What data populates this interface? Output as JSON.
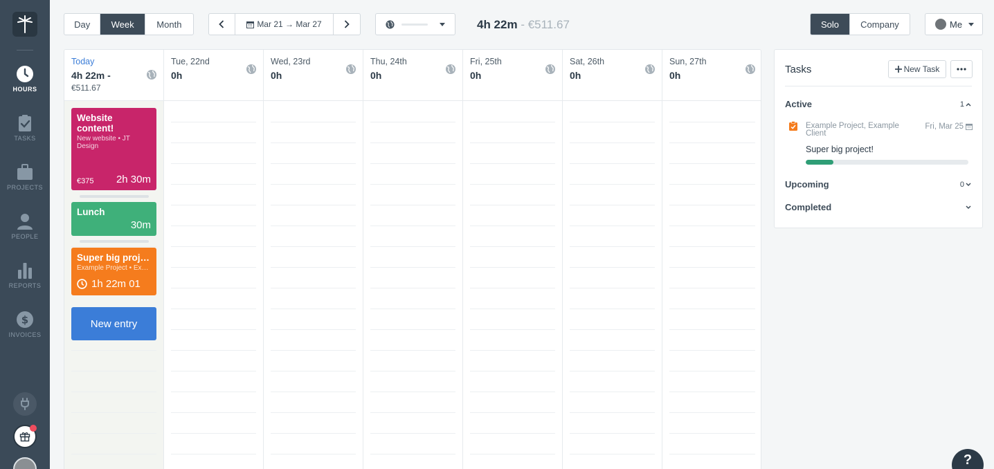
{
  "sidebar": {
    "items": [
      {
        "label": "HOURS",
        "icon": "clock-icon",
        "active": true
      },
      {
        "label": "TASKS",
        "icon": "clipboard-check-icon",
        "active": false
      },
      {
        "label": "PROJECTS",
        "icon": "briefcase-icon",
        "active": false
      },
      {
        "label": "PEOPLE",
        "icon": "person-icon",
        "active": false
      },
      {
        "label": "REPORTS",
        "icon": "bar-chart-icon",
        "active": false
      },
      {
        "label": "INVOICES",
        "icon": "dollar-icon",
        "active": false
      }
    ]
  },
  "toolbar": {
    "views": [
      "Day",
      "Week",
      "Month"
    ],
    "active_view": "Week",
    "date_range": "Mar 21 → Mar 27",
    "total_time": "4h 22m",
    "total_sep": " - ",
    "total_money": "€511.67",
    "modes": [
      "Solo",
      "Company"
    ],
    "active_mode": "Solo",
    "user": "Me"
  },
  "calendar": {
    "today": {
      "label": "Today",
      "hours": "4h 22m -",
      "money": "€511.67"
    },
    "days": [
      {
        "label": "Tue, 22nd",
        "hours": "0h"
      },
      {
        "label": "Wed, 23rd",
        "hours": "0h"
      },
      {
        "label": "Thu, 24th",
        "hours": "0h"
      },
      {
        "label": "Fri, 25th",
        "hours": "0h"
      },
      {
        "label": "Sat, 26th",
        "hours": "0h"
      },
      {
        "label": "Sun, 27th",
        "hours": "0h"
      }
    ],
    "entries": {
      "website": {
        "title": "Website content!",
        "sub": "New website • JT Design",
        "price": "€375",
        "duration": "2h 30m",
        "color": "#c8256a"
      },
      "lunch": {
        "title": "Lunch",
        "duration": "30m",
        "color": "#3fb07a"
      },
      "super": {
        "title": "Super big project!",
        "sub": "Example Project • Example Client",
        "timer": "1h 22m 01",
        "color": "#f57c1d"
      }
    },
    "new_entry": "New entry"
  },
  "tasks": {
    "title": "Tasks",
    "new_task": "New Task",
    "sections": {
      "active": {
        "label": "Active",
        "count": "1"
      },
      "upcoming": {
        "label": "Upcoming",
        "count": "0"
      },
      "completed": {
        "label": "Completed"
      }
    },
    "item": {
      "project": "Example Project, Example Client",
      "date": "Fri, Mar 25",
      "name": "Super big project!",
      "progress": 0.17
    }
  },
  "help": "?"
}
